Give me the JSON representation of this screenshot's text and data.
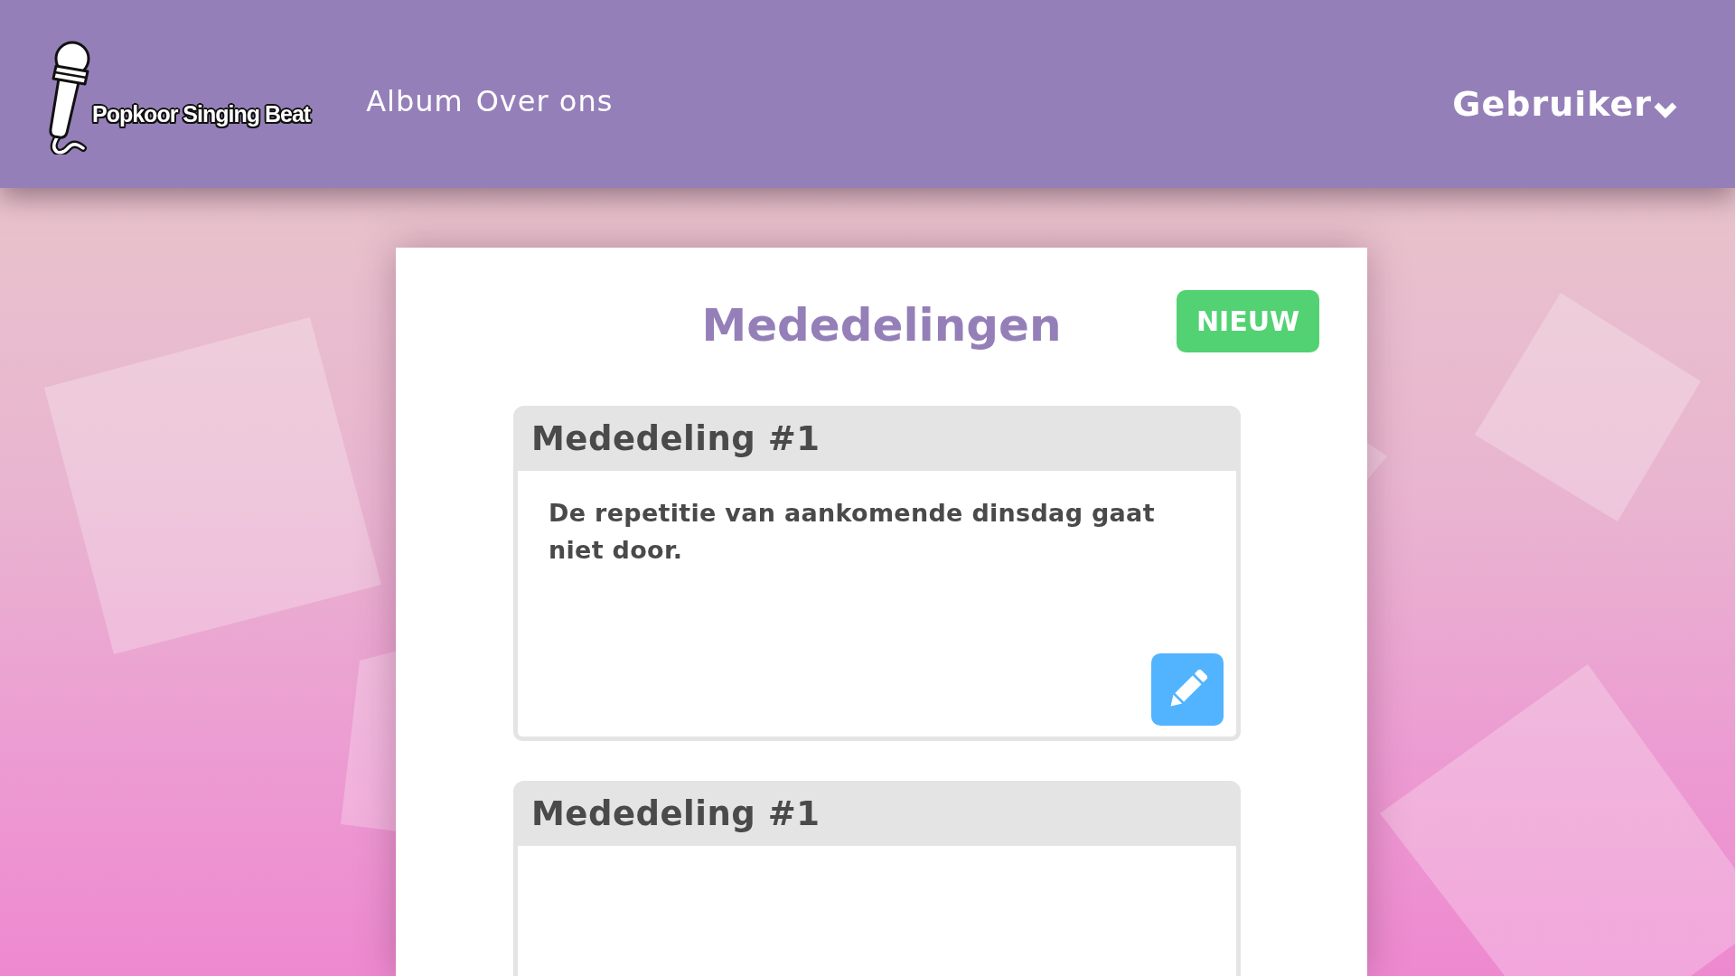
{
  "header": {
    "logo_text": "Popkoor Singing Beat",
    "nav": [
      {
        "label": "Album"
      },
      {
        "label": "Over ons"
      }
    ],
    "user_menu": {
      "label": "Gebruiker"
    }
  },
  "page": {
    "title": "Mededelingen",
    "new_button": "NIEUW",
    "announcements": [
      {
        "title": "Mededeling #1",
        "text": "De repetitie van aankomende dinsdag gaat niet door."
      },
      {
        "title": "Mededeling #1"
      }
    ]
  }
}
